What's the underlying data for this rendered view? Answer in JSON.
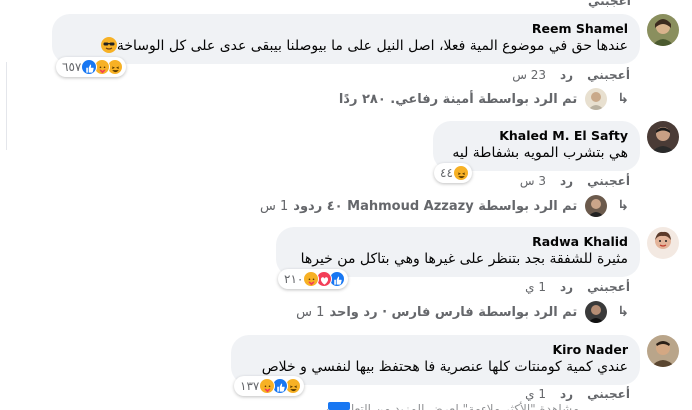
{
  "comments": [
    {
      "author": "Reem Shamel",
      "text": "عندها حق في موضوع المية فعلا، اصل النيل على ما بيوصلنا بيبقى عدى على كل الوساخة",
      "reaction_count": "٦٥٧",
      "like": "أعجبني",
      "reply": "رد",
      "time": "23 س",
      "replies_label": "تم الرد بواسطة أمينة رفاعي. ٢٨٠ ردًا",
      "replies_time": ""
    },
    {
      "author": "Khaled M. El Safty",
      "text": "هي بتشرب المويه بشفاطة ليه",
      "reaction_count": "٤٤",
      "like": "أعجبني",
      "reply": "رد",
      "time": "3 س",
      "replies_label": "تم الرد بواسطة Mahmoud Azzazy ٤٠ ردود",
      "replies_time": "1 س"
    },
    {
      "author": "Radwa Khalid",
      "text": "مثيرة للشفقة بجد بتنظر على غيرها وهي بتاكل من خيرها",
      "reaction_count": "٢١٠",
      "like": "أعجبني",
      "reply": "رد",
      "time": "1 ي",
      "replies_label": "تم الرد بواسطة فارس فارس · رد واحد",
      "replies_time": "1 س"
    },
    {
      "author": "Kiro Nader",
      "text": "عندي كمية كومنتات كلها عنصرية فا هحتفظ بيها لنفسي و خلاص",
      "reaction_count": "١٣٧",
      "like": "أعجبني",
      "reply": "رد",
      "time": "1 ي",
      "replies_label": "",
      "replies_time": ""
    }
  ],
  "top_partial": {
    "like": "أعجبني"
  },
  "bottom_partial": "مشاهدة \"الأكثر ملاءمة\" لعرض المزيد من التعليقات",
  "icons": {
    "reply_arrow": "reply-arrow-icon",
    "like_reaction": "like-reaction-icon",
    "haha_reaction": "haha-reaction-icon",
    "love_reaction": "love-reaction-icon",
    "care_reaction": "care-reaction-icon",
    "sunglasses_emoji": "sunglasses-emoji-icon"
  },
  "colors": {
    "bubble": "#f0f2f5",
    "secondary_text": "#65676b",
    "like_blue": "#1877f2",
    "love_red": "#f33e58",
    "haha_yellow": "#f7b125"
  }
}
